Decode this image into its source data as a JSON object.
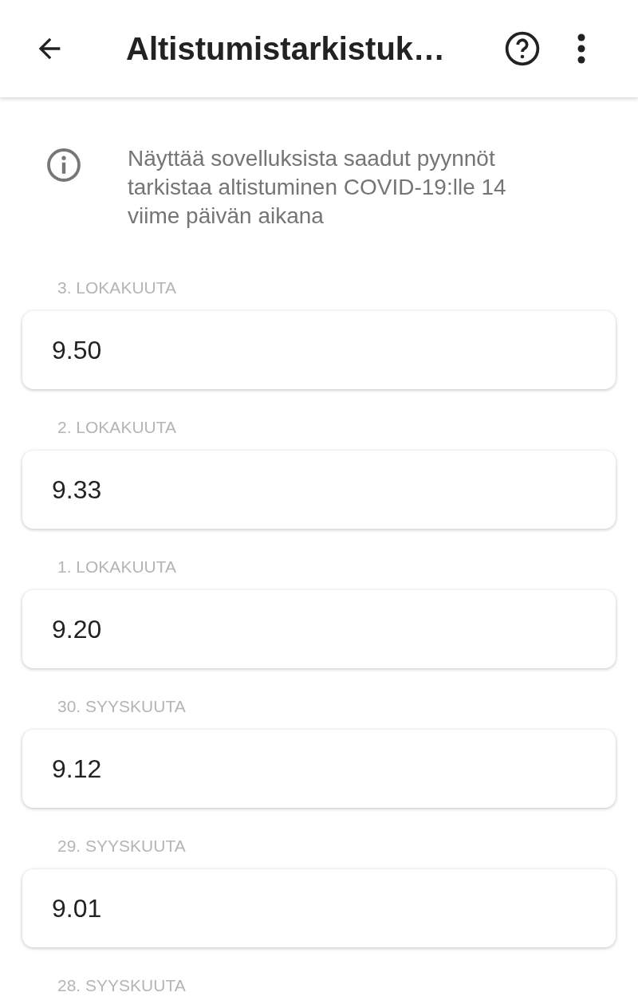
{
  "app_bar": {
    "title": "Altistumistarkistuk…"
  },
  "info": {
    "text": "Näyttää sovelluksista saadut pyynnöt tarkistaa altistuminen COVID-19:lle 14 viime päivän aikana"
  },
  "days": [
    {
      "date": "3. LOKAKUUTA",
      "checks": [
        "9.50"
      ]
    },
    {
      "date": "2. LOKAKUUTA",
      "checks": [
        "9.33"
      ]
    },
    {
      "date": "1. LOKAKUUTA",
      "checks": [
        "9.20"
      ]
    },
    {
      "date": "30. SYYSKUUTA",
      "checks": [
        "9.12"
      ]
    },
    {
      "date": "29. SYYSKUUTA",
      "checks": [
        "9.01"
      ]
    },
    {
      "date": "28. SYYSKUUTA"
    }
  ]
}
